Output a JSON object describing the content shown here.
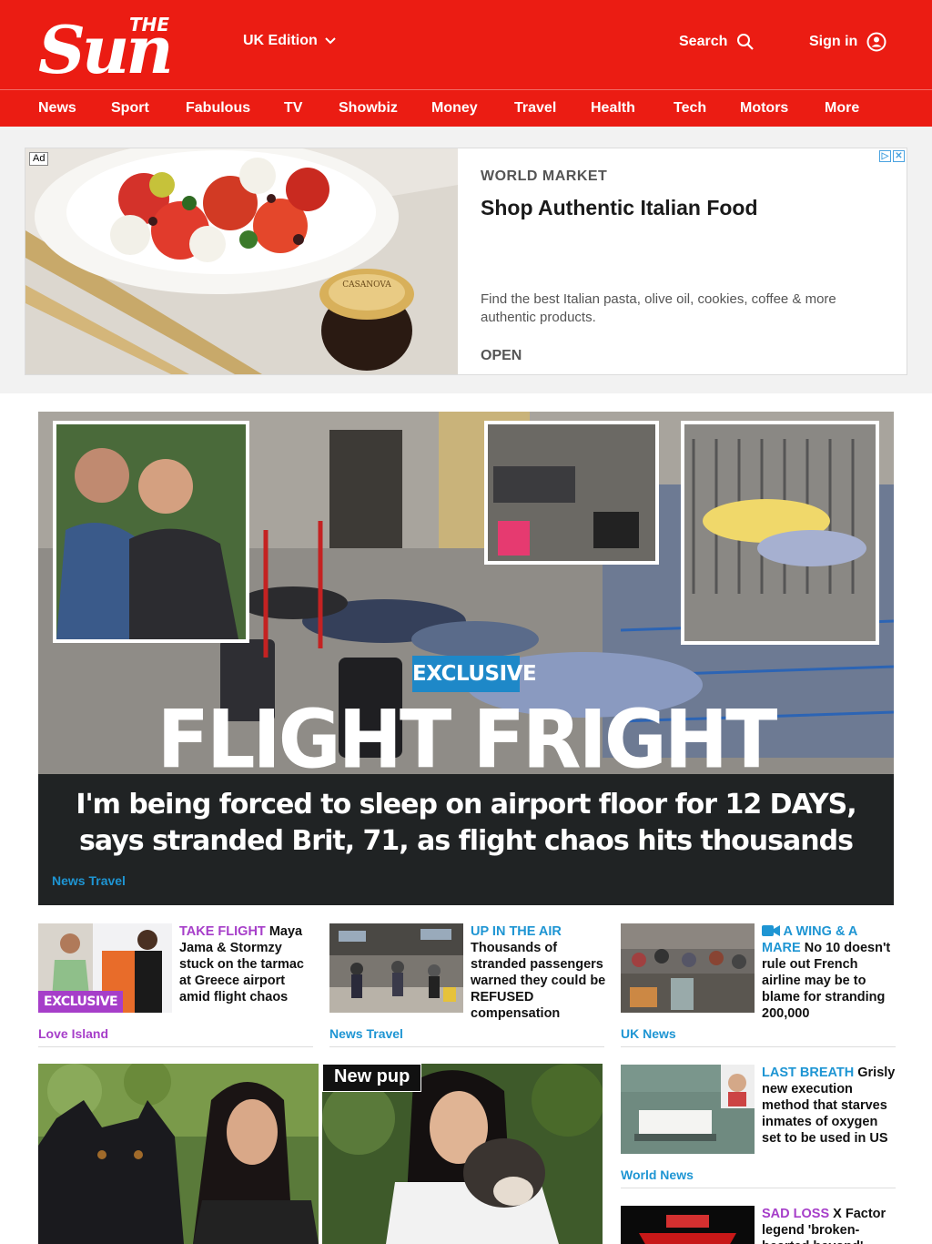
{
  "header": {
    "edition_label": "UK Edition",
    "search_label": "Search",
    "signin_label": "Sign in",
    "brand_color": "#eb1c13"
  },
  "logo": {
    "the": "THE",
    "sun": "Sun"
  },
  "nav": [
    "News",
    "Sport",
    "Fabulous",
    "TV",
    "Showbiz",
    "Money",
    "Travel",
    "Health",
    "Tech",
    "Motors",
    "More"
  ],
  "ad": {
    "label": "Ad",
    "brand": "WORLD MARKET",
    "headline": "Shop Authentic Italian Food",
    "body": "Find the best Italian pasta, olive oil, cookies, coffee & more authentic products.",
    "cta": "OPEN",
    "jar_label": "CASANOVA"
  },
  "hero": {
    "badge": "EXCLUSIVE",
    "title": "FLIGHT FRIGHT",
    "subtitle": "I'm being forced to sleep on airport floor for 12 DAYS, says stranded Brit, 71, as flight chaos hits thousands",
    "category": "News Travel"
  },
  "teasers": [
    {
      "kicker": "TAKE FLIGHT",
      "kicker_color": "#a63ec9",
      "headline": "Maya Jama & Stormzy stuck on the tarmac at Greece airport amid flight chaos",
      "category": "Love Island",
      "category_color": "#a63ec9",
      "badge": "EXCLUSIVE"
    },
    {
      "kicker": "UP IN THE AIR",
      "kicker_color": "#1e95d3",
      "headline": "Thousands of stranded passengers warned they could be REFUSED compensation",
      "category": "News Travel",
      "category_color": "#1e95d3"
    },
    {
      "kicker": "A WING & A MARE",
      "kicker_color": "#1e95d3",
      "headline": "No 10 doesn't rule out French airline may be to blame for stranding 200,000",
      "category": "UK News",
      "category_color": "#1e95d3",
      "icon": "video-camera-icon"
    },
    {
      "kicker": "LAST BREATH",
      "kicker_color": "#1e95d3",
      "headline": "Grisly new execution method that starves inmates of oxygen set to be used in US",
      "category": "World News",
      "category_color": "#1e95d3"
    },
    {
      "kicker": "SAD LOSS",
      "kicker_color": "#a63ec9",
      "headline": "X Factor legend 'broken-hearted beyond'",
      "category": ""
    }
  ],
  "pup": {
    "badge": "New pup"
  }
}
